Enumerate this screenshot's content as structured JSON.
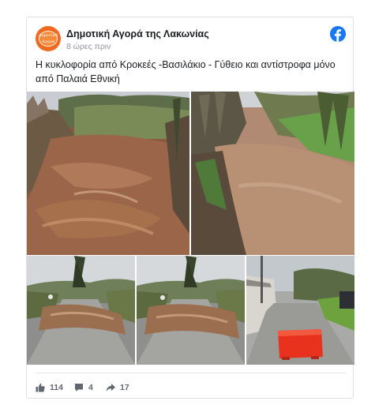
{
  "post": {
    "page_name": "Δημοτική Αγορά της Λακωνίας",
    "avatar_text_line1": "Δημοτική",
    "avatar_text_line2": "Αγορά",
    "timestamp": "8 ώρες πριν",
    "text": "Η κυκλοφορία από Κροκεές -Βασιλάκιο - Γύθειο και αντίστροφα μόνο από Παλαιά Εθνική"
  },
  "photos": [
    {
      "name": "flooded-river-photo-1"
    },
    {
      "name": "flooded-river-photo-2"
    },
    {
      "name": "flooded-road-photo-3"
    },
    {
      "name": "flooded-road-photo-4"
    },
    {
      "name": "road-barrier-photo-5"
    }
  ],
  "actions": {
    "likes": "114",
    "comments": "4",
    "shares": "17"
  },
  "colors": {
    "facebook_blue": "#1877f2",
    "avatar_orange": "#f06a22",
    "text": "#1c1e21",
    "muted": "#90949c"
  },
  "icons": [
    "facebook-logo-icon",
    "like-icon",
    "comment-icon",
    "share-icon"
  ]
}
